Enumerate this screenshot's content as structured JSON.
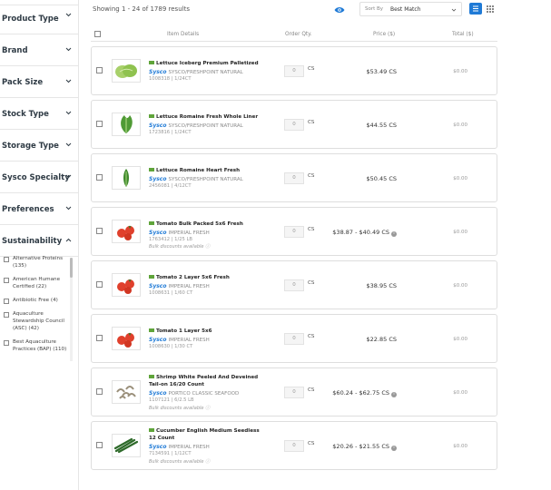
{
  "filters": [
    {
      "label": "Product Type",
      "expanded": false
    },
    {
      "label": "Brand",
      "expanded": false
    },
    {
      "label": "Pack Size",
      "expanded": false
    },
    {
      "label": "Stock Type",
      "expanded": false
    },
    {
      "label": "Storage Type",
      "expanded": false
    },
    {
      "label": "Sysco Specialty",
      "expanded": false
    },
    {
      "label": "Preferences",
      "expanded": false
    },
    {
      "label": "Sustainability",
      "expanded": true
    }
  ],
  "sustainability_options": [
    "Alternative Proteins (135)",
    "American Humane Certified (22)",
    "Antibiotic Free (4)",
    "Aquaculture Stewardship Council (ASC) (42)",
    "Best Aquaculture Practices (BAP) (110)"
  ],
  "toolbar": {
    "results_text": "Showing 1 - 24 of 1789 results",
    "sort_label": "Sort By",
    "sort_value": "Best Match"
  },
  "columns": {
    "item_details": "Item Details",
    "order_qty": "Order Qty.",
    "price": "Price ($)",
    "total": "Total ($)"
  },
  "products": [
    {
      "name": "Lettuce Iceberg Premium Palletized",
      "brand": "Sysco",
      "supplier": "SYSCO/FRESHPOINT NATURAL",
      "sku": "1008318 | 1/24CT",
      "bulk": "",
      "qty": "0",
      "unit": "CS",
      "price": "$53.49 CS",
      "info": false,
      "total": "$0.00",
      "image": "lettuce-iceberg"
    },
    {
      "name": "Lettuce Romaine Fresh Whole Liner",
      "brand": "Sysco",
      "supplier": "SYSCO/FRESHPOINT NATURAL",
      "sku": "1723816 | 1/24CT",
      "bulk": "",
      "qty": "0",
      "unit": "CS",
      "price": "$44.55 CS",
      "info": false,
      "total": "$0.00",
      "image": "lettuce-romaine"
    },
    {
      "name": "Lettuce Romaine Heart Fresh",
      "brand": "Sysco",
      "supplier": "SYSCO/FRESHPOINT NATURAL",
      "sku": "2456081 | 4/12CT",
      "bulk": "",
      "qty": "0",
      "unit": "CS",
      "price": "$50.45 CS",
      "info": false,
      "total": "$0.00",
      "image": "romaine-heart"
    },
    {
      "name": "Tomato Bulk Packed 5x6 Fresh",
      "brand": "Sysco",
      "supplier": "IMPERIAL FRESH",
      "sku": "1763412 | 1/25 LB",
      "bulk": "Bulk discounts available ⓘ",
      "qty": "0",
      "unit": "CS",
      "price": "$38.87 - $40.49 CS",
      "info": true,
      "total": "$0.00",
      "image": "tomato"
    },
    {
      "name": "Tomato 2 Layer 5x6 Fresh",
      "brand": "Sysco",
      "supplier": "IMPERIAL FRESH",
      "sku": "1008631 | 1/60 CT",
      "bulk": "",
      "qty": "0",
      "unit": "CS",
      "price": "$38.95 CS",
      "info": false,
      "total": "$0.00",
      "image": "tomato"
    },
    {
      "name": "Tomato 1 Layer 5x6",
      "brand": "Sysco",
      "supplier": "IMPERIAL FRESH",
      "sku": "1008630 | 1/30 CT",
      "bulk": "",
      "qty": "0",
      "unit": "CS",
      "price": "$22.85 CS",
      "info": false,
      "total": "$0.00",
      "image": "tomato"
    },
    {
      "name": "Shrimp White Peeled And Deveined Tail-on 16/20 Count",
      "brand": "Sysco",
      "supplier": "PORTICO CLASSIC SEAFOOD",
      "sku": "1107121 | 6/2.5 LB",
      "bulk": "Bulk discounts available ⓘ",
      "qty": "0",
      "unit": "CS",
      "price": "$60.24 - $62.75 CS",
      "info": true,
      "total": "$0.00",
      "image": "shrimp"
    },
    {
      "name": "Cucumber English Medium Seedless 12 Count",
      "brand": "Sysco",
      "supplier": "IMPERIAL FRESH",
      "sku": "7134591 | 1/12CT",
      "bulk": "Bulk discounts available ⓘ",
      "qty": "0",
      "unit": "CS",
      "price": "$20.26 - $21.55 CS",
      "info": true,
      "total": "$0.00",
      "image": "cucumber"
    }
  ],
  "colors": {
    "accent": "#1f7ad6",
    "tag_green": "#5fa43a",
    "tomato": "#e0402c"
  }
}
